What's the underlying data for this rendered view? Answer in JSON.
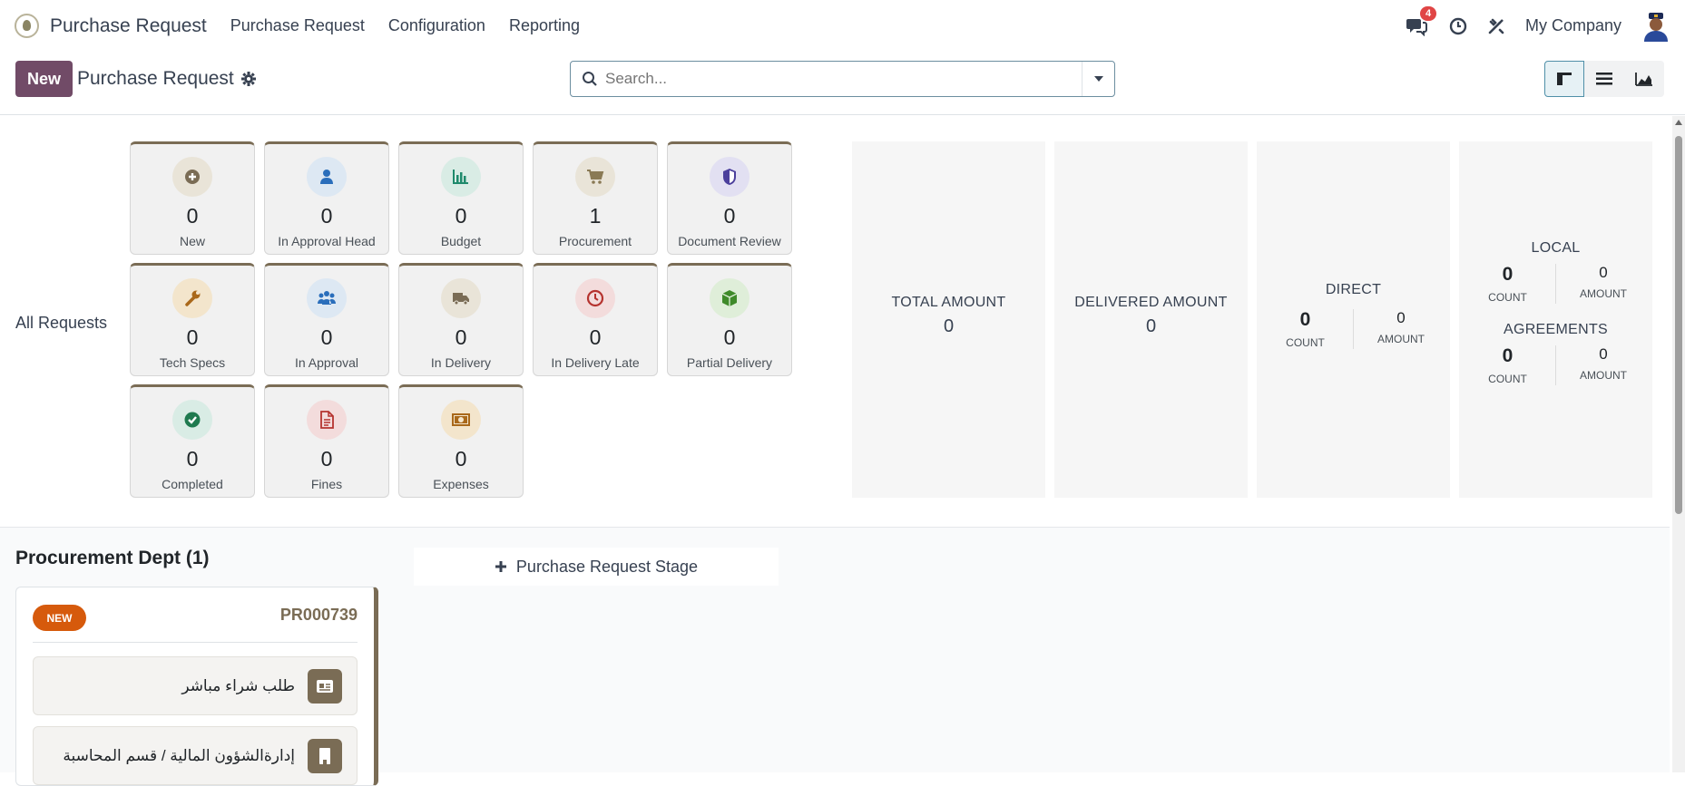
{
  "navbar": {
    "app_title": "Purchase Request",
    "menu": [
      "Purchase Request",
      "Configuration",
      "Reporting"
    ],
    "chat_badge": "4",
    "company": "My Company"
  },
  "control": {
    "new_label": "New",
    "breadcrumb": "Purchase Request",
    "search_placeholder": "Search..."
  },
  "dashboard": {
    "all_requests_label": "All Requests",
    "tiles": [
      {
        "label": "New",
        "count": "0",
        "icon": "plus-circle-icon",
        "color": "#7a6c55",
        "bg": "#e9e4d8"
      },
      {
        "label": "In Approval Head",
        "count": "0",
        "icon": "user-icon",
        "color": "#2a6ebb",
        "bg": "#dde8f3"
      },
      {
        "label": "Budget",
        "count": "0",
        "icon": "bar-chart-icon",
        "color": "#1f8a6c",
        "bg": "#d9ece5"
      },
      {
        "label": "Procurement",
        "count": "1",
        "icon": "cart-icon",
        "color": "#8a7a55",
        "bg": "#e9e4d8"
      },
      {
        "label": "Document Review",
        "count": "0",
        "icon": "shield-icon",
        "color": "#4b3f9c",
        "bg": "#e2e0f2"
      },
      {
        "label": "Tech Specs",
        "count": "0",
        "icon": "wrench-icon",
        "color": "#a9681a",
        "bg": "#f3e5cc"
      },
      {
        "label": "In Approval",
        "count": "0",
        "icon": "users-icon",
        "color": "#2a6ebb",
        "bg": "#dde8f3"
      },
      {
        "label": "In Delivery",
        "count": "0",
        "icon": "truck-icon",
        "color": "#7a6c55",
        "bg": "#e9e4d8"
      },
      {
        "label": "In Delivery Late",
        "count": "0",
        "icon": "clock-icon",
        "color": "#b5332f",
        "bg": "#f3dcdc"
      },
      {
        "label": "Partial Delivery",
        "count": "0",
        "icon": "cube-icon",
        "color": "#3f8a2a",
        "bg": "#dfeed9"
      },
      {
        "label": "Completed",
        "count": "0",
        "icon": "check-circle-icon",
        "color": "#1f7a4f",
        "bg": "#d9ece5"
      },
      {
        "label": "Fines",
        "count": "0",
        "icon": "document-icon",
        "color": "#b5332f",
        "bg": "#f3dcdc"
      },
      {
        "label": "Expenses",
        "count": "0",
        "icon": "money-icon",
        "color": "#a9681a",
        "bg": "#f3e5cc"
      }
    ],
    "total": {
      "title": "TOTAL AMOUNT",
      "value": "0"
    },
    "delivered": {
      "title": "DELIVERED AMOUNT",
      "value": "0"
    },
    "direct": {
      "title": "DIRECT",
      "count": "0",
      "amount": "0",
      "count_label": "COUNT",
      "amount_label": "AMOUNT"
    },
    "local": {
      "title": "LOCAL",
      "count": "0",
      "amount": "0",
      "count_label": "COUNT",
      "amount_label": "AMOUNT"
    },
    "agreements": {
      "title": "AGREEMENTS",
      "count": "0",
      "amount": "0",
      "count_label": "COUNT",
      "amount_label": "AMOUNT"
    }
  },
  "kanban": {
    "column_title": "Procurement Dept (1)",
    "add_stage_label": "Purchase Request Stage",
    "card": {
      "badge": "NEW",
      "ref": "PR000739",
      "line1": "طلب شراء مباشر",
      "line2": "إدارةالشؤون المالية / قسم المحاسبة"
    }
  }
}
